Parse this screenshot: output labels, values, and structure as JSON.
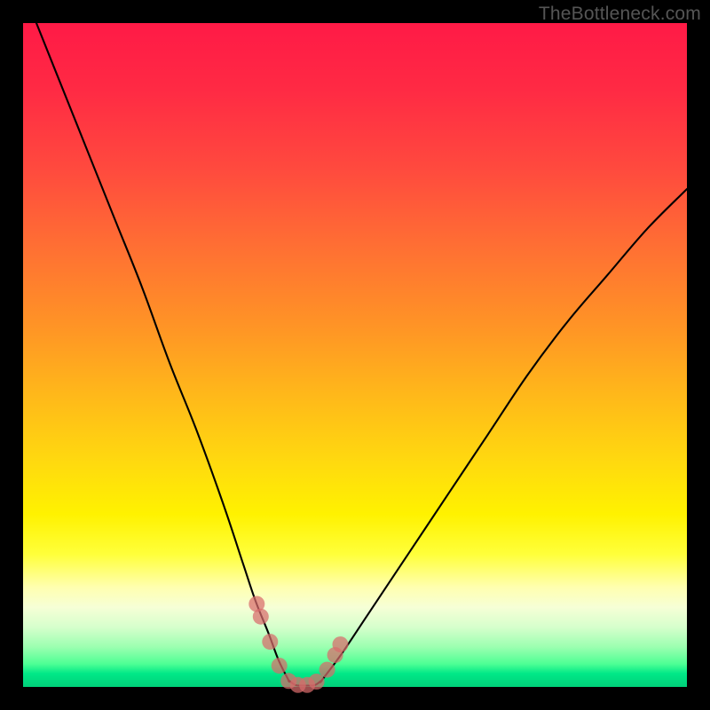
{
  "watermark": "TheBottleneck.com",
  "chart_data": {
    "type": "line",
    "title": "",
    "xlabel": "",
    "ylabel": "",
    "xlim": [
      0,
      100
    ],
    "ylim": [
      0,
      100
    ],
    "series": [
      {
        "name": "left-branch",
        "x": [
          2,
          6,
          10,
          14,
          18,
          22,
          26,
          30,
          33,
          35,
          37,
          38.5,
          40
        ],
        "y": [
          100,
          90,
          80,
          70,
          60,
          49,
          39,
          28,
          19,
          13,
          8,
          4,
          1
        ]
      },
      {
        "name": "floor",
        "x": [
          40,
          41,
          42,
          43,
          44,
          45
        ],
        "y": [
          1,
          0.3,
          0.2,
          0.2,
          0.3,
          1
        ]
      },
      {
        "name": "right-branch",
        "x": [
          45,
          48,
          52,
          58,
          64,
          70,
          76,
          82,
          88,
          94,
          100
        ],
        "y": [
          1,
          5,
          11,
          20,
          29,
          38,
          47,
          55,
          62,
          69,
          75
        ]
      }
    ],
    "markers": {
      "name": "highlight-points",
      "x": [
        35.2,
        35.8,
        37.2,
        38.6,
        40.0,
        41.4,
        42.8,
        44.2,
        45.8,
        47.0,
        47.8
      ],
      "y": [
        12.5,
        10.6,
        6.8,
        3.2,
        0.9,
        0.3,
        0.3,
        0.8,
        2.6,
        4.8,
        6.4
      ]
    },
    "colors": {
      "curve": "#000000",
      "marker": "#d86b6b",
      "gradient_top": "#ff1a46",
      "gradient_bottom": "#00d07a"
    }
  }
}
